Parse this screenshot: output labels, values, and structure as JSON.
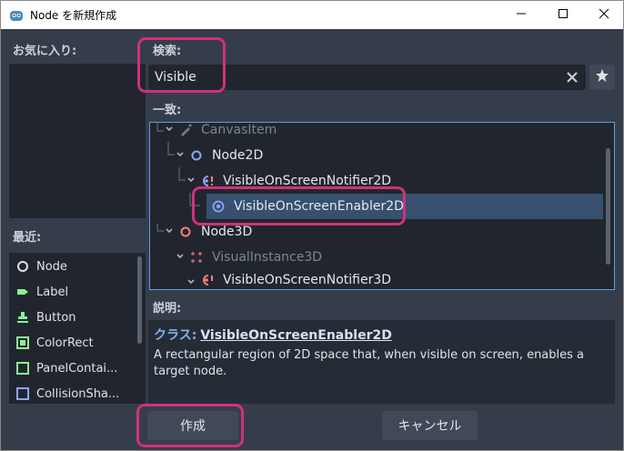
{
  "window": {
    "title": "Node を新規作成",
    "icon": "godot-icon"
  },
  "favorites": {
    "label": "お気に入り:"
  },
  "recent": {
    "label": "最近:",
    "items": [
      {
        "label": "Node",
        "icon": "node-circle-icon",
        "color": "#dfe3ea"
      },
      {
        "label": "Label",
        "icon": "label-tag-icon",
        "color": "#8eef97"
      },
      {
        "label": "Button",
        "icon": "button-icon",
        "color": "#8eef97"
      },
      {
        "label": "ColorRect",
        "icon": "colorrect-icon",
        "color": "#8eef97"
      },
      {
        "label": "PanelContai...",
        "icon": "panelcontainer-icon",
        "color": "#8eef97"
      },
      {
        "label": "CollisionSha...",
        "icon": "collisionshape-icon",
        "color": "#8da5f3"
      }
    ]
  },
  "search": {
    "label": "検索:",
    "value": "Visible"
  },
  "matches": {
    "label": "一致:",
    "items": [
      {
        "label": "CanvasItem",
        "icon": "canvasitem-icon",
        "dim": true
      },
      {
        "label": "Node2D",
        "icon": "node2d-icon",
        "dim": false
      },
      {
        "label": "VisibleOnScreenNotifier2D",
        "icon": "notifier2d-icon",
        "dim": false
      },
      {
        "label": "VisibleOnScreenEnabler2D",
        "icon": "enabler2d-icon",
        "dim": false,
        "selected": true
      },
      {
        "label": "Node3D",
        "icon": "node3d-icon",
        "dim": false
      },
      {
        "label": "VisualInstance3D",
        "icon": "visualinstance3d-icon",
        "dim": true
      },
      {
        "label": "VisibleOnScreenNotifier3D",
        "icon": "notifier3d-icon",
        "dim": false
      }
    ]
  },
  "description": {
    "label": "説明:",
    "class_prefix": "クラス:",
    "class_name": "VisibleOnScreenEnabler2D",
    "text": "A rectangular region of 2D space that, when visible on screen, enables a target node."
  },
  "buttons": {
    "create": "作成",
    "cancel": "キャンセル"
  },
  "colors": {
    "accent": "#5b9ee6",
    "highlight": "#d3307a",
    "node2d": "#8da5f3",
    "node3d": "#fc7f7f",
    "control": "#8eef97"
  }
}
